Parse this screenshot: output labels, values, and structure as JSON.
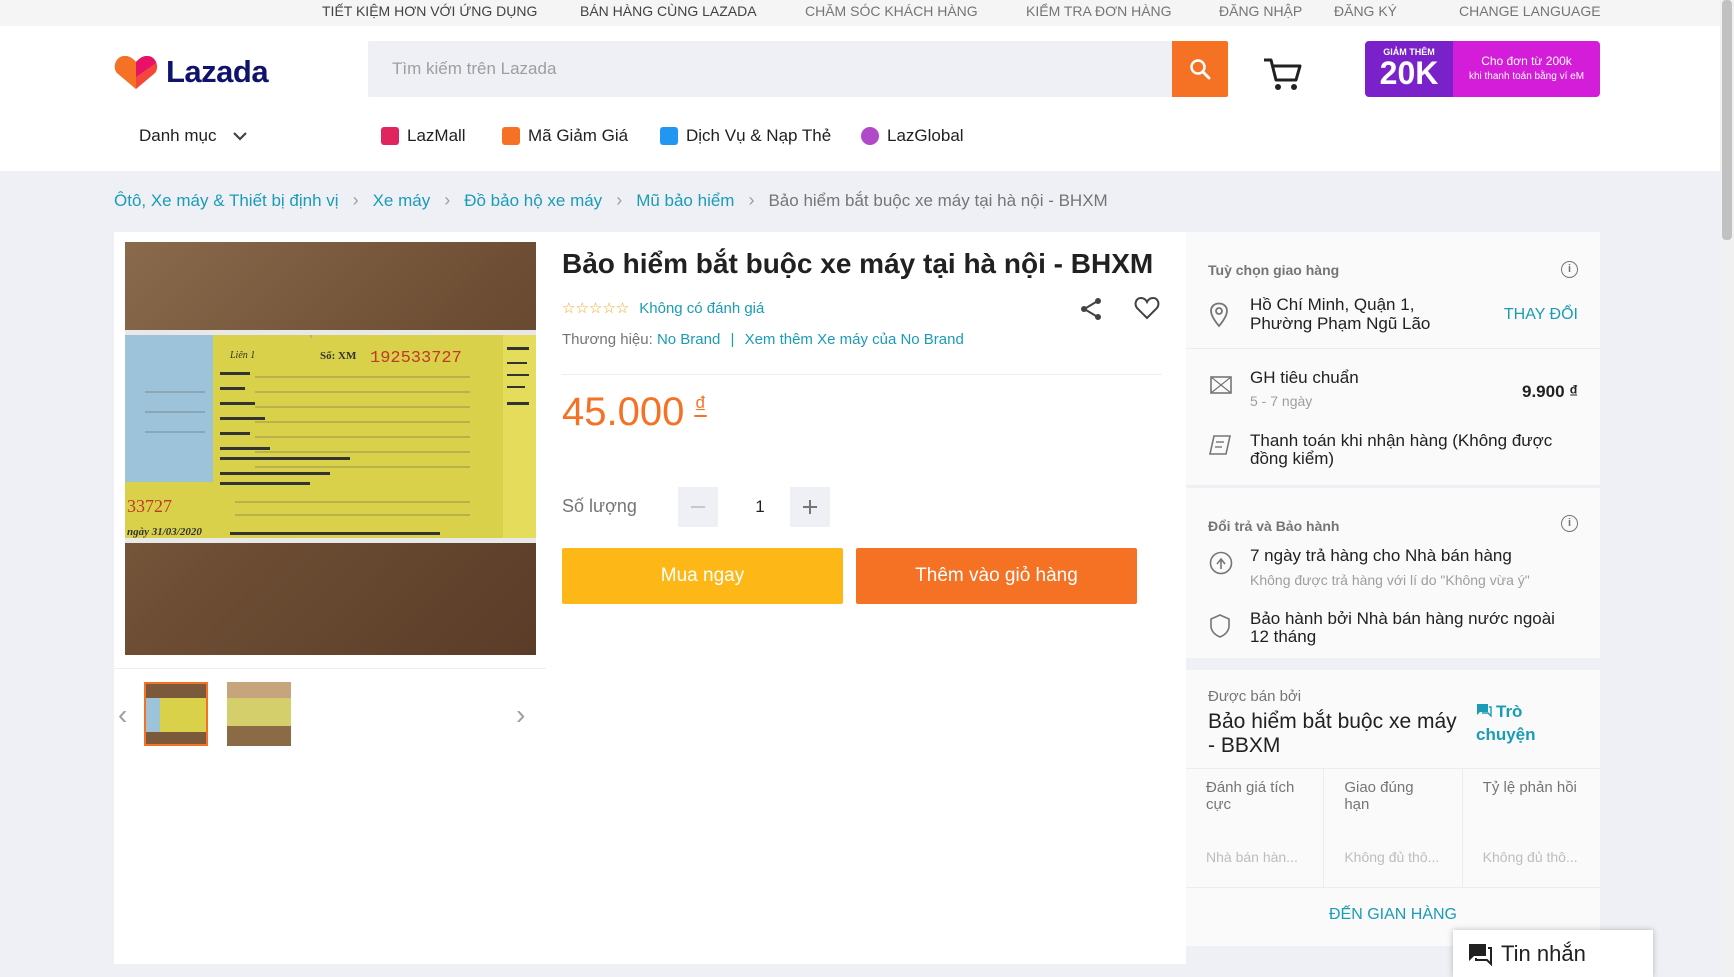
{
  "topbar": {
    "links": [
      "TIẾT KIỆM HƠN VỚI ỨNG DỤNG",
      "BÁN HÀNG CÙNG LAZADA",
      "CHĂM SÓC KHÁCH HÀNG",
      "KIỂM TRA ĐƠN HÀNG",
      "ĐĂNG NHẬP",
      "ĐĂNG KÝ",
      "CHANGE LANGUAGE"
    ]
  },
  "header": {
    "logo_text": "Lazada",
    "search_placeholder": "Tìm kiếm trên Lazada",
    "promo": {
      "label_small": "GIẢM THÊM",
      "label_big": "20K",
      "line1": "Cho đơn từ 200k",
      "line2": "khi thanh toán bằng ví eM"
    },
    "nav": {
      "category": "Danh mục",
      "items": [
        "LazMall",
        "Mã Giảm Giá",
        "Dịch Vụ & Nạp Thẻ",
        "LazGlobal"
      ]
    }
  },
  "breadcrumb": {
    "items": [
      "Ôtô, Xe máy & Thiết bị định vị",
      "Xe máy",
      "Đồ bảo hộ xe máy",
      "Mũ bảo hiểm"
    ],
    "current": "Bảo hiểm bắt buộc xe máy tại hà nội - BHXM"
  },
  "product": {
    "title": "Bảo hiểm bắt buộc xe máy tại hà nội - BHXM",
    "stars": "☆☆☆☆☆",
    "rating_text": "Không có đánh giá",
    "brand_label": "Thương hiệu:",
    "brand": "No Brand",
    "brand_more": "Xem thêm Xe máy của No Brand",
    "price": "45.000",
    "currency": "₫",
    "quantity_label": "Số lượng",
    "quantity": "1",
    "buy_now": "Mua ngay",
    "add_to_cart": "Thêm vào giỏ hàng",
    "image": {
      "lien": "Liên 1",
      "so_label": "Số: XM",
      "serial": "192533727",
      "serial_partial": "33727",
      "date": "ngày 31/03/2020"
    }
  },
  "delivery": {
    "heading": "Tuỳ chọn giao hàng",
    "address_line1": "Hồ Chí Minh, Quận 1,",
    "address_line2": "Phường Phạm Ngũ Lão",
    "change": "THAY ĐỔI",
    "shipping_name": "GH tiêu chuẩn",
    "shipping_time": "5 - 7 ngày",
    "shipping_fee": "9.900 ₫",
    "cod_line1": "Thanh toán khi nhận hàng (Không được",
    "cod_line2": "đồng kiểm)"
  },
  "returns": {
    "heading": "Đổi trả và Bảo hành",
    "return_title": "7 ngày trả hàng cho Nhà bán hàng",
    "return_sub": "Không được trả hàng với lí do \"Không vừa ý\"",
    "warranty_line1": "Bảo hành bởi Nhà bán hàng nước ngoài",
    "warranty_line2": "12 tháng"
  },
  "seller": {
    "sold_by": "Được bán bởi",
    "name_line1": "Bảo hiểm bắt buộc xe máy",
    "name_line2": "- BBXM",
    "chat_line1": "Trò",
    "chat_line2": "chuyện",
    "metrics": [
      {
        "label": "Đánh giá tích cực",
        "value": "Nhà bán hàn..."
      },
      {
        "label": "Giao đúng hạn",
        "value": "Không đủ thô..."
      },
      {
        "label": "Tỷ lệ phản hồi",
        "value": "Không đủ thô..."
      }
    ],
    "visit_store": "ĐẾN GIAN HÀNG"
  },
  "chat_widget": {
    "label": "Tin nhắn"
  },
  "colors": {
    "accent": "#f57224",
    "link": "#1a9cb7",
    "buy": "#fdb818",
    "promo_left": "#7a21c9",
    "promo_right": "#d31dd8"
  }
}
